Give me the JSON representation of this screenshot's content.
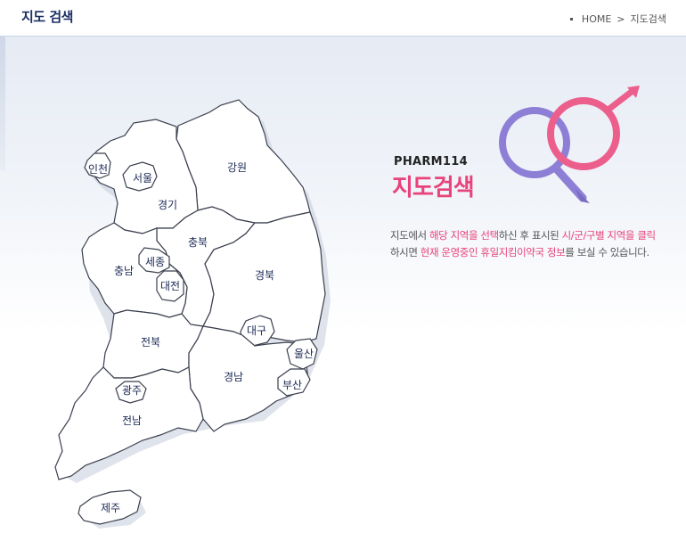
{
  "header": {
    "title": "지도 검색",
    "breadcrumb": [
      "HOME",
      ">",
      "지도검색"
    ]
  },
  "info": {
    "brand": "PHARM114",
    "title": "지도검색",
    "desc_1": "지도에서 ",
    "desc_hl1": "해당 지역을 선택",
    "desc_2": "하신 후 표시된 ",
    "desc_hl2": "시/군/구별 지역을 클릭",
    "desc_3": "하시면 ",
    "desc_hl3": "현재 운영중인 휴일지킴이약국 정보",
    "desc_4": "를 보실 수 있습니다."
  },
  "regions": {
    "incheon": "인천",
    "seoul": "서울",
    "gyeonggi": "경기",
    "gangwon": "강원",
    "chungbuk": "충북",
    "chungnam": "충남",
    "sejong": "세종",
    "daejeon": "대전",
    "gyeongbuk": "경북",
    "daegu": "대구",
    "jeonbuk": "전북",
    "gyeongnam": "경남",
    "ulsan": "울산",
    "busan": "부산",
    "gwangju": "광주",
    "jeonnam": "전남",
    "jeju": "제주"
  },
  "colors": {
    "accent": "#e8447a",
    "accent_ring": "#ec5f8c",
    "purple_ring": "#8e7fd6",
    "title_navy": "#1b2f63",
    "region_label": "#1b2a55"
  },
  "icons": {
    "logo": "intersecting-rings-icon"
  }
}
